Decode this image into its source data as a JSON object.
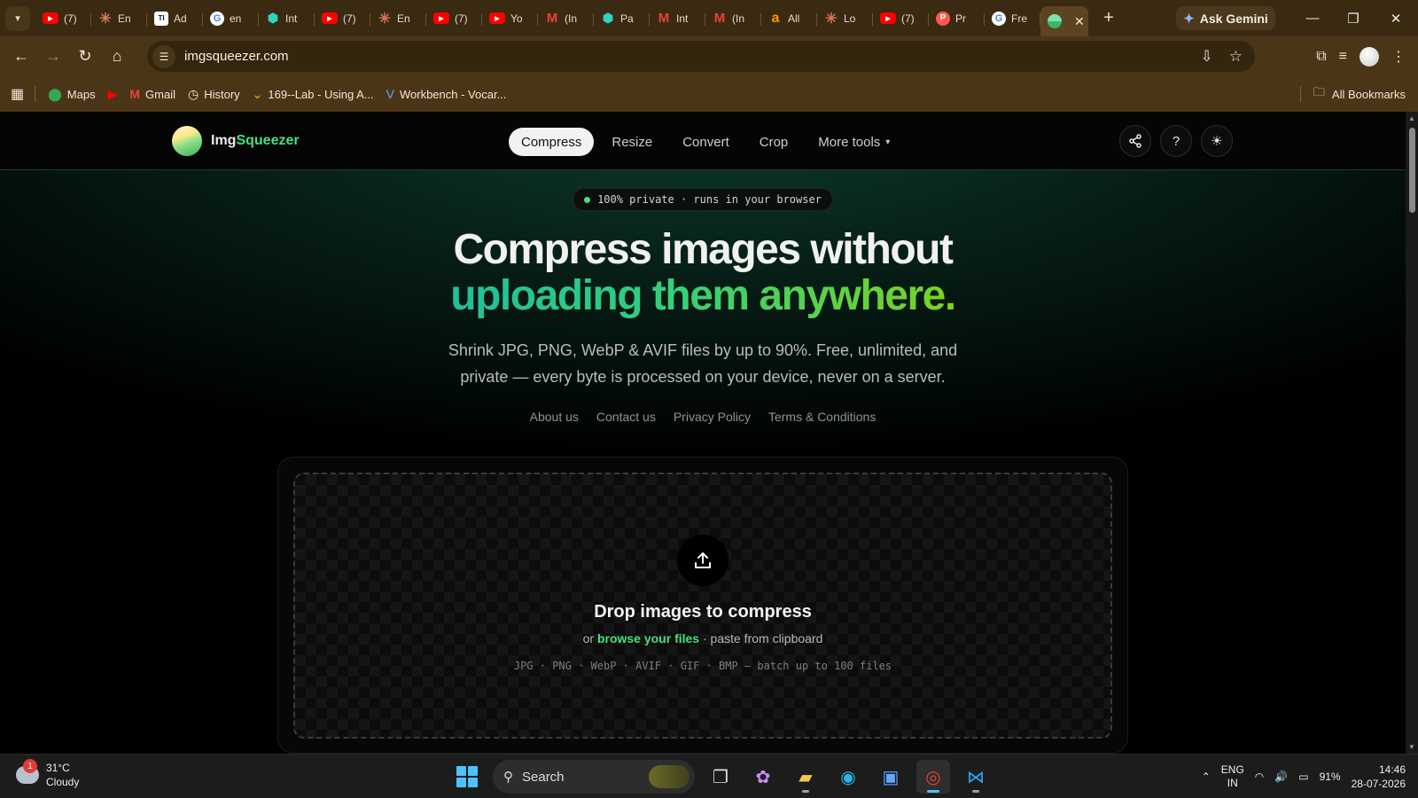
{
  "browser": {
    "tabs": [
      {
        "icon": "youtube-icon",
        "label": "(7)"
      },
      {
        "icon": "claude-icon",
        "label": "En"
      },
      {
        "icon": "ti-icon",
        "label": "Ad"
      },
      {
        "icon": "google-icon",
        "label": "en"
      },
      {
        "icon": "shield-icon",
        "label": "Int"
      },
      {
        "icon": "youtube-icon",
        "label": "(7)"
      },
      {
        "icon": "claude-icon",
        "label": "En"
      },
      {
        "icon": "youtube-icon",
        "label": "(7)"
      },
      {
        "icon": "youtube-icon",
        "label": "Yo"
      },
      {
        "icon": "gmail-icon",
        "label": "(In"
      },
      {
        "icon": "shield-icon",
        "label": "Pa"
      },
      {
        "icon": "gmail-icon",
        "label": "Int"
      },
      {
        "icon": "gmail-icon",
        "label": "(In"
      },
      {
        "icon": "amazon-icon",
        "label": "All"
      },
      {
        "icon": "claude-icon",
        "label": "Lo"
      },
      {
        "icon": "youtube-icon",
        "label": "(7)"
      },
      {
        "icon": "p-icon",
        "label": "Pr"
      },
      {
        "icon": "google-icon",
        "label": "Fre"
      }
    ],
    "ask_gemini": "Ask Gemini",
    "url": "imgsqueezer.com",
    "bookmarks": {
      "maps": "Maps",
      "gmail": "Gmail",
      "history": "History",
      "lab": "169--Lab - Using A...",
      "workbench": "Workbench - Vocar...",
      "all": "All Bookmarks"
    }
  },
  "site": {
    "logo_a": "Img",
    "logo_b": "Squeezer",
    "nav": {
      "compress": "Compress",
      "resize": "Resize",
      "convert": "Convert",
      "crop": "Crop",
      "more": "More tools"
    },
    "badge": "100% private · runs in your browser",
    "headline_1": "Compress images without",
    "headline_2": "uploading them anywhere.",
    "subtitle": "Shrink JPG, PNG, WebP & AVIF files by up to 90%. Free, unlimited, and private — every byte is processed on your device, never on a server.",
    "links": {
      "about": "About us",
      "contact": "Contact us",
      "privacy": "Privacy Policy",
      "terms": "Terms & Conditions"
    },
    "dropzone": {
      "title": "Drop images to compress",
      "or": "or",
      "browse": "browse your files",
      "paste": "· paste from clipboard",
      "formats": "JPG · PNG · WebP · AVIF · GIF · BMP — batch up to 100 files"
    }
  },
  "taskbar": {
    "weather_temp": "31°C",
    "weather_cond": "Cloudy",
    "weather_badge": "1",
    "search": "Search",
    "lang_1": "ENG",
    "lang_2": "IN",
    "battery": "91%",
    "time": "14:46",
    "date": "28-07-2026"
  }
}
